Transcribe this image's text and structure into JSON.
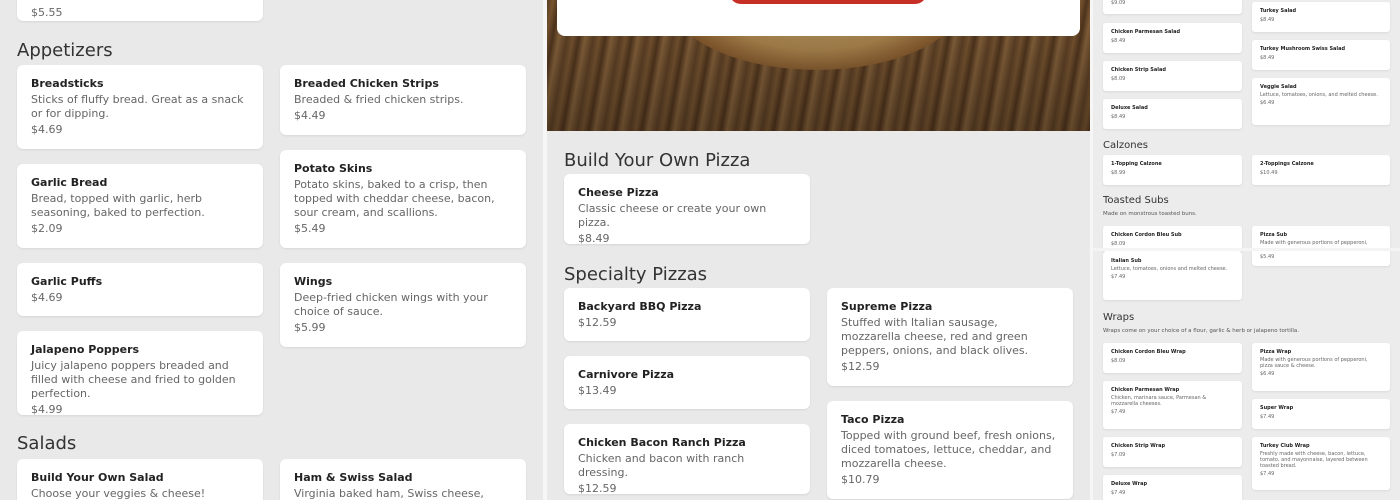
{
  "panel1": {
    "top_price": "$5.55",
    "appetizers": {
      "title": "Appetizers",
      "items": [
        {
          "name": "Breadsticks",
          "desc": "Sticks of fluffy bread. Great as a snack or for dipping.",
          "price": "$4.69"
        },
        {
          "name": "Breaded Chicken Strips",
          "desc": "Breaded & fried chicken strips.",
          "price": "$4.49"
        },
        {
          "name": "Garlic Bread",
          "desc": "Bread, topped with garlic, herb seasoning, baked to perfection.",
          "price": "$2.09"
        },
        {
          "name": "Potato Skins",
          "desc": "Potato skins, baked to a crisp, then topped with cheddar cheese, bacon, sour cream, and scallions.",
          "price": "$5.49"
        },
        {
          "name": "Garlic Puffs",
          "desc": "",
          "price": "$4.69"
        },
        {
          "name": "Wings",
          "desc": "Deep-fried chicken wings with your choice of sauce.",
          "price": "$5.99"
        },
        {
          "name": "Jalapeno Poppers",
          "desc": "Juicy jalapeno poppers breaded and filled with cheese and fried to golden perfection.",
          "price": "$4.99"
        }
      ]
    },
    "salads": {
      "title": "Salads",
      "items": [
        {
          "name": "Build Your Own Salad",
          "desc": "Choose your veggies & cheese!"
        },
        {
          "name": "Ham & Swiss Salad",
          "desc": "Virginia baked ham, Swiss cheese, lettuce,"
        }
      ]
    }
  },
  "panel2": {
    "byo": {
      "title": "Build Your Own Pizza",
      "items": [
        {
          "name": "Cheese Pizza",
          "desc": "Classic cheese or create your own pizza.",
          "price": "$8.49"
        }
      ]
    },
    "specialty": {
      "title": "Specialty Pizzas",
      "items": [
        {
          "name": "Backyard BBQ Pizza",
          "desc": "",
          "price": "$12.59"
        },
        {
          "name": "Supreme Pizza",
          "desc": "Stuffed with Italian sausage, mozzarella cheese, red and green peppers, onions, and black olives.",
          "price": "$12.59"
        },
        {
          "name": "Carnivore Pizza",
          "desc": "",
          "price": "$13.49"
        },
        {
          "name": "Taco Pizza",
          "desc": "Topped with ground beef, fresh onions, diced tomatoes, lettuce, cheddar, and mozzarella cheese.",
          "price": "$10.79"
        },
        {
          "name": "Chicken Bacon Ranch Pizza",
          "desc": "Chicken and bacon with ranch dressing.",
          "price": "$12.59"
        }
      ]
    }
  },
  "panel3": {
    "salads": [
      {
        "name": "",
        "desc": "",
        "price": "$9.09"
      },
      {
        "name": "Turkey Salad",
        "desc": "",
        "price": "$8.49"
      },
      {
        "name": "Chicken Parmesan Salad",
        "desc": "",
        "price": "$8.49"
      },
      {
        "name": "Turkey Mushroom Swiss Salad",
        "desc": "",
        "price": "$8.49"
      },
      {
        "name": "Chicken Strip Salad",
        "desc": "",
        "price": "$8.09"
      },
      {
        "name": "Veggie Salad",
        "desc": "Lettuce, tomatoes, onions, and melted cheese.",
        "price": "$6.49"
      },
      {
        "name": "Deluxe Salad",
        "desc": "",
        "price": "$8.49"
      }
    ],
    "calzones": {
      "title": "Calzones",
      "items": [
        {
          "name": "1-Topping Calzone",
          "desc": "",
          "price": "$8.99"
        },
        {
          "name": "2-Toppings Calzone",
          "desc": "",
          "price": "$10.49"
        }
      ]
    },
    "subs": {
      "title": "Toasted Subs",
      "desc": "Made on monstrous toasted buns.",
      "items": [
        {
          "name": "Chicken Cordon Bleu Sub",
          "desc": "",
          "price": "$8.09"
        },
        {
          "name": "Pizza Sub",
          "desc": "Made with generous portions of pepperoni,",
          "price": "$5.49"
        },
        {
          "name": "Italian Sub",
          "desc": "Lettuce, tomatoes, onions and melted cheese.",
          "price": "$7.49"
        }
      ]
    },
    "wraps": {
      "title": "Wraps",
      "desc": "Wraps come on your choice of a flour, garlic & herb or jalapeno tortilla.",
      "items": [
        {
          "name": "Chicken Cordon Bleu Wrap",
          "desc": "",
          "price": "$8.09"
        },
        {
          "name": "Pizza Wrap",
          "desc": "Made with generous portions of pepperoni, pizza sauce & cheese.",
          "price": "$6.49"
        },
        {
          "name": "Chicken Parmesan Wrap",
          "desc": "Chicken, marinara sauce, Parmesan & mozzarella cheeses.",
          "price": "$7.49"
        },
        {
          "name": "Super Wrap",
          "desc": "",
          "price": "$7.49"
        },
        {
          "name": "Chicken Strip Wrap",
          "desc": "",
          "price": "$7.09"
        },
        {
          "name": "Turkey Club Wrap",
          "desc": "Freshly made with cheese, bacon, lettuce, tomato, and mayonnaise, layered between toasted bread.",
          "price": "$7.49"
        },
        {
          "name": "Deluxe Wrap",
          "desc": "",
          "price": "$7.49"
        }
      ]
    }
  },
  "colors": {
    "accent": "#c62f26",
    "background": "#e9e9e9",
    "card": "#ffffff"
  }
}
